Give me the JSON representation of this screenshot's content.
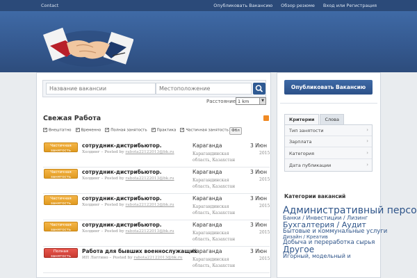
{
  "topbar": {
    "contact": "Contact",
    "links": [
      "Опубликовать Вакансию",
      "Обзор резюме",
      "Вход или Регистрация"
    ]
  },
  "logo": {
    "icon": "handshake-icon"
  },
  "search": {
    "title_placeholder": "Название вакансии",
    "location_placeholder": "Местоположение",
    "distance_label": "Расстояние",
    "distance_value": "1 km"
  },
  "fresh": {
    "title": "Свежая Работа",
    "filters": [
      "Внештатно",
      "Временно",
      "Полная занятость",
      "Практика",
      "Частичная занятость"
    ],
    "filter_button": "Фбл"
  },
  "jobs": [
    {
      "badge": "Частичная занятость",
      "type": "part",
      "title": "сотрудник-дистрибьютор.",
      "company": "Холдинг",
      "posted": "Posted by",
      "email": "rabota22122013@bk.ru",
      "location": "Караганда",
      "region": "Карагандинская область, Казахстан",
      "date": "3 Июн",
      "year": "2015"
    },
    {
      "badge": "Частичная занятость",
      "type": "part",
      "title": "сотрудник-дистрибьютор.",
      "company": "Холдинг",
      "posted": "Posted by",
      "email": "rabota22122013@bk.ru",
      "location": "Караганда",
      "region": "Карагандинская область, Казахстан",
      "date": "3 Июн",
      "year": "2015"
    },
    {
      "badge": "Частичная занятость",
      "type": "part",
      "title": "сотрудник-дистрибьютор.",
      "company": "Холдинг",
      "posted": "Posted by",
      "email": "rabota22122013@bk.ru",
      "location": "Караганда",
      "region": "Карагандинская область, Казахстан",
      "date": "3 Июн",
      "year": "2015"
    },
    {
      "badge": "Частичная занятость",
      "type": "part",
      "title": "сотрудник-дистрибьютор.",
      "company": "Холдинг",
      "posted": "Posted by",
      "email": "rabota22122013@bk.ru",
      "location": "Караганда",
      "region": "Карагандинская область, Казахстан",
      "date": "3 Июн",
      "year": "2015"
    },
    {
      "badge": "Полная занятость",
      "type": "full",
      "title": "Работа для бывших военнослужащих",
      "company": "ИП Логгино",
      "posted": "Posted by",
      "email": "rabota22122013@bk.ru",
      "location": "Караганда",
      "region": "Карагандинская область, Казахстан",
      "date": "3 Июн",
      "year": "2015"
    }
  ],
  "sidebar": {
    "post_button": "Опубликовать Вакансию",
    "tabs": [
      "Критерии",
      "Слова"
    ],
    "criteria": [
      "Тип занятости",
      "Зарплата",
      "Категория",
      "Дата публикации"
    ],
    "categories_title": "Категории вакансий",
    "tags": [
      {
        "text": "Административный персонал",
        "size": 14
      },
      {
        "text": "Банки / Инвестиции / Лизинг",
        "size": 8
      },
      {
        "text": "Бухгалтерия / Аудит",
        "size": 11
      },
      {
        "text": "Бытовые и коммунальные услуги",
        "size": 8.5
      },
      {
        "text": "Дизайн / Креатив",
        "size": 7
      },
      {
        "text": "Добыча и переработка сырья",
        "size": 8.5
      },
      {
        "text": "Другое",
        "size": 12
      },
      {
        "text": "Игорный, модельный и",
        "size": 8
      }
    ]
  }
}
